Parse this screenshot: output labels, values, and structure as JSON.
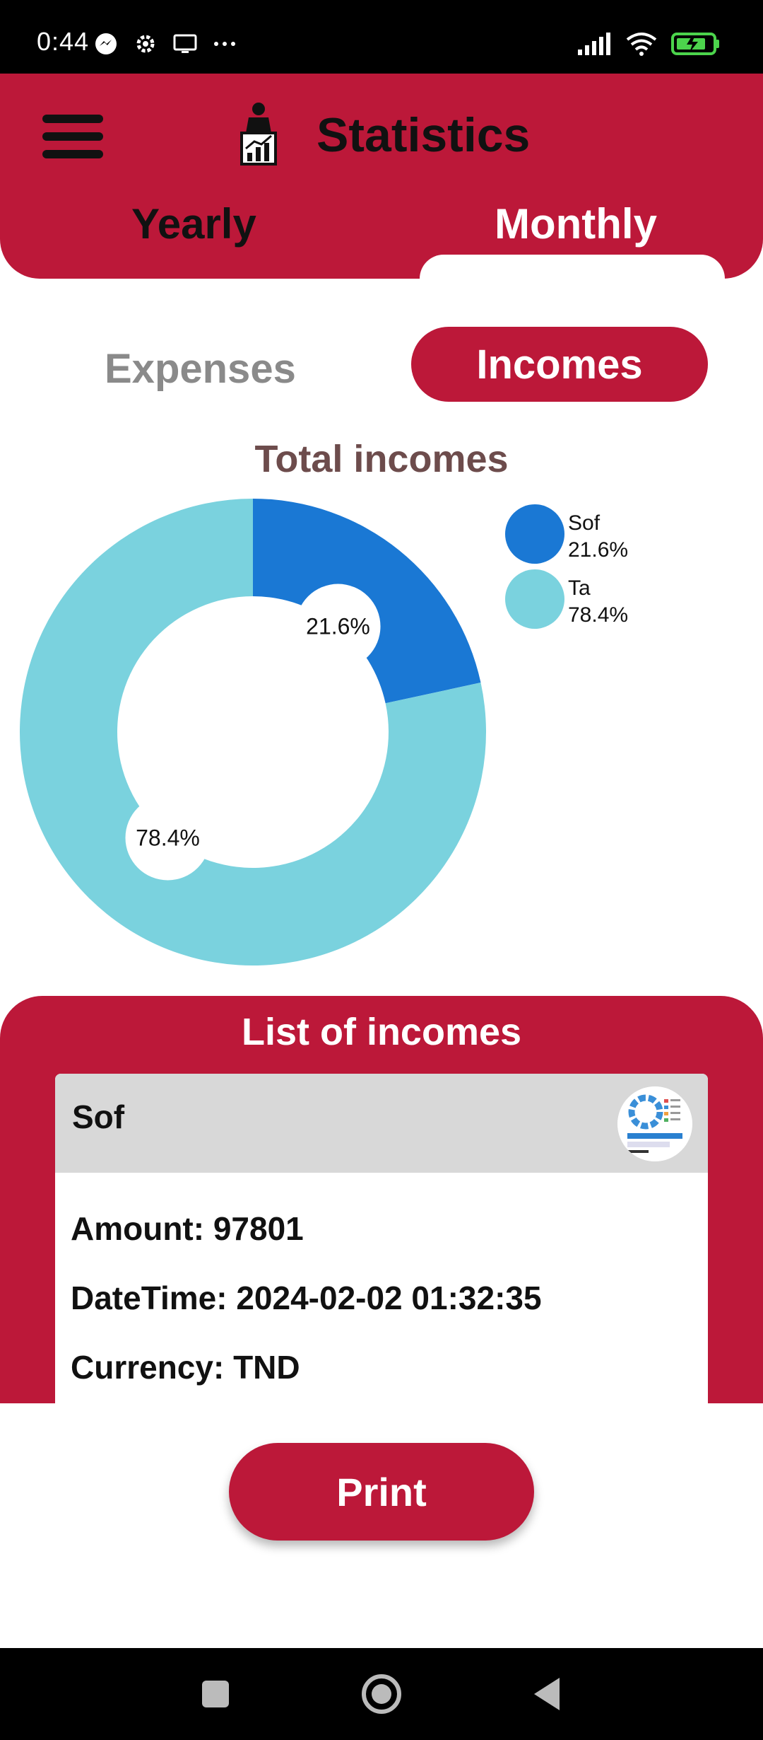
{
  "status_bar": {
    "time": "0:44",
    "left_icons": [
      "messenger-icon",
      "gear-icon",
      "screen-icon",
      "more-dots-icon"
    ],
    "right_icons": [
      "signal-icon",
      "wifi-icon",
      "battery-charging-icon"
    ]
  },
  "header": {
    "title": "Statistics",
    "tabs": [
      {
        "label": "Yearly",
        "selected": false
      },
      {
        "label": "Monthly",
        "selected": true
      }
    ]
  },
  "toggle": {
    "expenses_label": "Expenses",
    "incomes_label": "Incomes",
    "selected": "Incomes"
  },
  "chart_data": {
    "type": "pie",
    "style": "donut",
    "title": "Total incomes",
    "categories": [
      "Sof",
      "Ta"
    ],
    "values": [
      21.6,
      78.4
    ],
    "labels": [
      "21.6%",
      "78.4%"
    ],
    "colors": [
      "#1a78d4",
      "#7ad2de"
    ],
    "legend": [
      {
        "name": "Sof",
        "percent": "21.6%"
      },
      {
        "name": "Ta",
        "percent": "78.4%"
      }
    ],
    "legend_position": "top-right"
  },
  "list": {
    "title": "List of incomes",
    "items": [
      {
        "name": "Sof",
        "amount_text": "Amount: 97801",
        "datetime_text": "DateTime: 2024-02-02 01:32:35",
        "currency_text": "Currency: TND"
      }
    ]
  },
  "actions": {
    "print_label": "Print"
  },
  "colors": {
    "primary": "#bc1839",
    "title_brown": "#6d4c4c",
    "muted": "#8a8a8a"
  }
}
